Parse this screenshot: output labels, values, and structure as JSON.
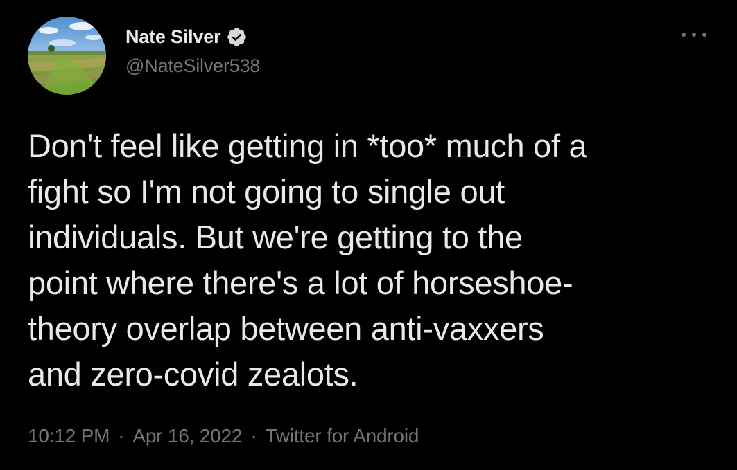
{
  "tweet": {
    "author": {
      "display_name": "Nate Silver",
      "handle": "@NateSilver538",
      "verified": true,
      "avatar_icon": "landscape-field-avatar"
    },
    "menu_icon": "more-horizontal-icon",
    "text": "Don't feel like getting in *too* much of a\nfight so I'm not going to single out\nindividuals. But we're getting to the\npoint where there's a lot of horseshoe-\ntheory overlap between anti-vaxxers\nand zero-covid zealots.",
    "meta": {
      "time": "10:12 PM",
      "separator": "·",
      "date": "Apr 16, 2022",
      "source": "Twitter for Android"
    }
  },
  "colors": {
    "background": "#000000",
    "primary_text": "#e7e9ea",
    "secondary_text": "#71767b",
    "verified_badge": "#d6d9db"
  }
}
